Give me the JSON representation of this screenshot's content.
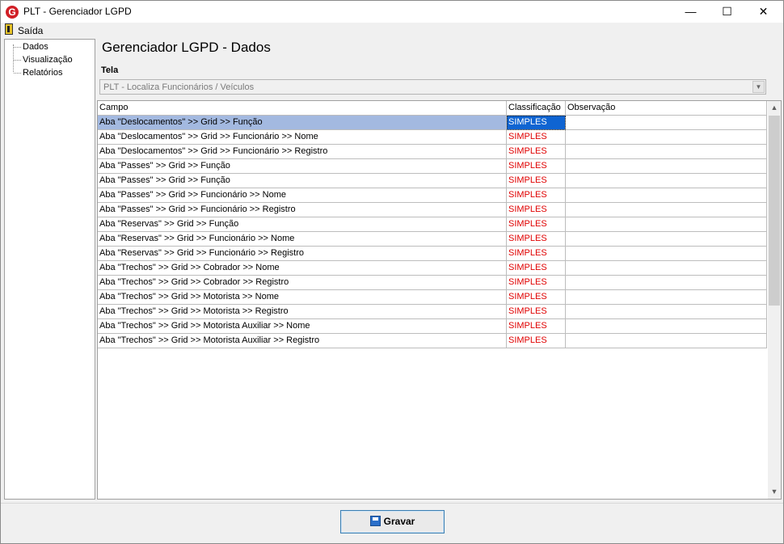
{
  "window": {
    "title": "PLT - Gerenciador LGPD",
    "minimize": "—",
    "maximize": "☐",
    "close": "✕",
    "app_icon": "G"
  },
  "menu": {
    "exit_label": "Saída"
  },
  "tree": {
    "items": [
      "Dados",
      "Visualização",
      "Relatórios"
    ]
  },
  "main": {
    "heading": "Gerenciador LGPD - Dados",
    "tela_label": "Tela",
    "tela_value": "PLT - Localiza Funcionários / Veículos"
  },
  "grid": {
    "columns": [
      "Campo",
      "Classificação",
      "Observação"
    ],
    "selected_row": 0,
    "rows": [
      {
        "campo": "Aba \"Deslocamentos\" >> Grid >> Função",
        "classificacao": "SIMPLES",
        "observacao": ""
      },
      {
        "campo": "Aba \"Deslocamentos\" >> Grid >> Funcionário >> Nome",
        "classificacao": "SIMPLES",
        "observacao": ""
      },
      {
        "campo": "Aba \"Deslocamentos\" >> Grid >> Funcionário >> Registro",
        "classificacao": "SIMPLES",
        "observacao": ""
      },
      {
        "campo": "Aba \"Passes\" >> Grid >> Função",
        "classificacao": "SIMPLES",
        "observacao": ""
      },
      {
        "campo": "Aba \"Passes\" >> Grid >> Função",
        "classificacao": "SIMPLES",
        "observacao": ""
      },
      {
        "campo": "Aba \"Passes\" >> Grid >> Funcionário >> Nome",
        "classificacao": "SIMPLES",
        "observacao": ""
      },
      {
        "campo": "Aba \"Passes\" >> Grid >> Funcionário >> Registro",
        "classificacao": "SIMPLES",
        "observacao": ""
      },
      {
        "campo": "Aba \"Reservas\" >> Grid >> Função",
        "classificacao": "SIMPLES",
        "observacao": ""
      },
      {
        "campo": "Aba \"Reservas\" >> Grid >> Funcionário >> Nome",
        "classificacao": "SIMPLES",
        "observacao": ""
      },
      {
        "campo": "Aba \"Reservas\" >> Grid >> Funcionário >> Registro",
        "classificacao": "SIMPLES",
        "observacao": ""
      },
      {
        "campo": "Aba \"Trechos\" >> Grid >> Cobrador >> Nome",
        "classificacao": "SIMPLES",
        "observacao": ""
      },
      {
        "campo": "Aba \"Trechos\" >> Grid >> Cobrador >> Registro",
        "classificacao": "SIMPLES",
        "observacao": ""
      },
      {
        "campo": "Aba \"Trechos\" >> Grid >> Motorista >> Nome",
        "classificacao": "SIMPLES",
        "observacao": ""
      },
      {
        "campo": "Aba \"Trechos\" >> Grid >> Motorista >> Registro",
        "classificacao": "SIMPLES",
        "observacao": ""
      },
      {
        "campo": "Aba \"Trechos\" >> Grid >> Motorista Auxiliar >> Nome",
        "classificacao": "SIMPLES",
        "observacao": ""
      },
      {
        "campo": "Aba \"Trechos\" >> Grid >> Motorista Auxiliar >> Registro",
        "classificacao": "SIMPLES",
        "observacao": ""
      }
    ]
  },
  "footer": {
    "save_label": "Gravar"
  },
  "colors": {
    "classificacao_text": "#e00000",
    "selected_cell": "#0f64d2",
    "selected_row": "#a3b9e0"
  }
}
